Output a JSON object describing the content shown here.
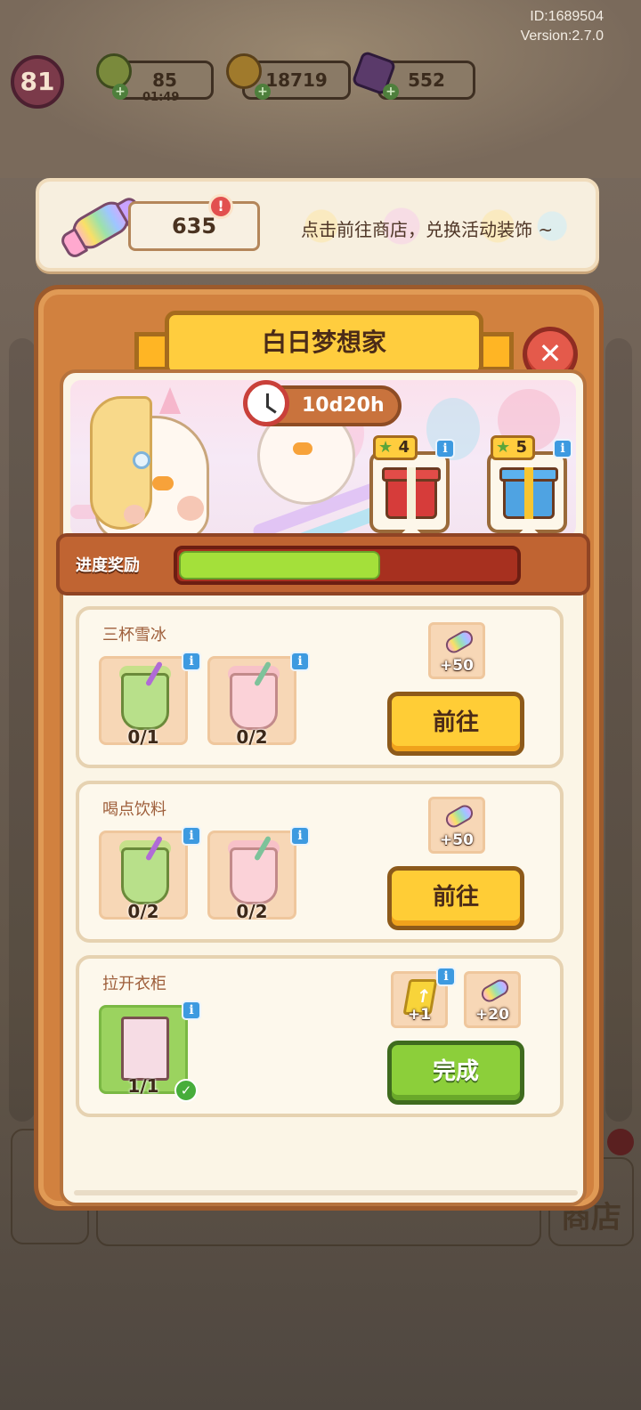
{
  "meta": {
    "id_text": "ID:1689504",
    "version_text": "Version:2.7.0"
  },
  "resources": {
    "level": "81",
    "energy": "85",
    "energy_timer": "01:49",
    "coins": "18719",
    "gems": "552"
  },
  "candy_banner": {
    "count": "635",
    "alert": "!",
    "message": "点击前往商店，兑换活动装饰 ~"
  },
  "event": {
    "title": "白日梦想家",
    "close_symbol": "✕",
    "timer": "10d20h",
    "gifts": [
      {
        "stars": "4",
        "color": "red"
      },
      {
        "stars": "5",
        "color": "blue"
      }
    ],
    "progress_label": "进度奖励",
    "progress_fraction": 0.6
  },
  "tasks": [
    {
      "title": "三杯雪冰",
      "items": [
        {
          "count": "0/1",
          "icon": "green-slush-icon"
        },
        {
          "count": "0/2",
          "icon": "pink-slush-icon"
        }
      ],
      "rewards": [
        "+50"
      ],
      "button": "前往",
      "state": "go"
    },
    {
      "title": "喝点饮料",
      "items": [
        {
          "count": "0/2",
          "icon": "green-slush-icon"
        },
        {
          "count": "0/2",
          "icon": "pink-slush-icon"
        }
      ],
      "rewards": [
        "+50"
      ],
      "button": "前往",
      "state": "go"
    },
    {
      "title": "拉开衣柜",
      "items": [
        {
          "count": "1/1",
          "icon": "wardrobe-icon"
        }
      ],
      "rewards": [
        "+1",
        "+20"
      ],
      "button": "完成",
      "state": "done"
    }
  ],
  "background": {
    "shop_label": "商店"
  },
  "colors": {
    "panel": "#d1813f",
    "ribbon": "#ffcd3e",
    "go_button": "#ffcd36",
    "done_button": "#8ccf3a",
    "progress_fill": "#a4e03a",
    "close": "#e45a4b"
  }
}
